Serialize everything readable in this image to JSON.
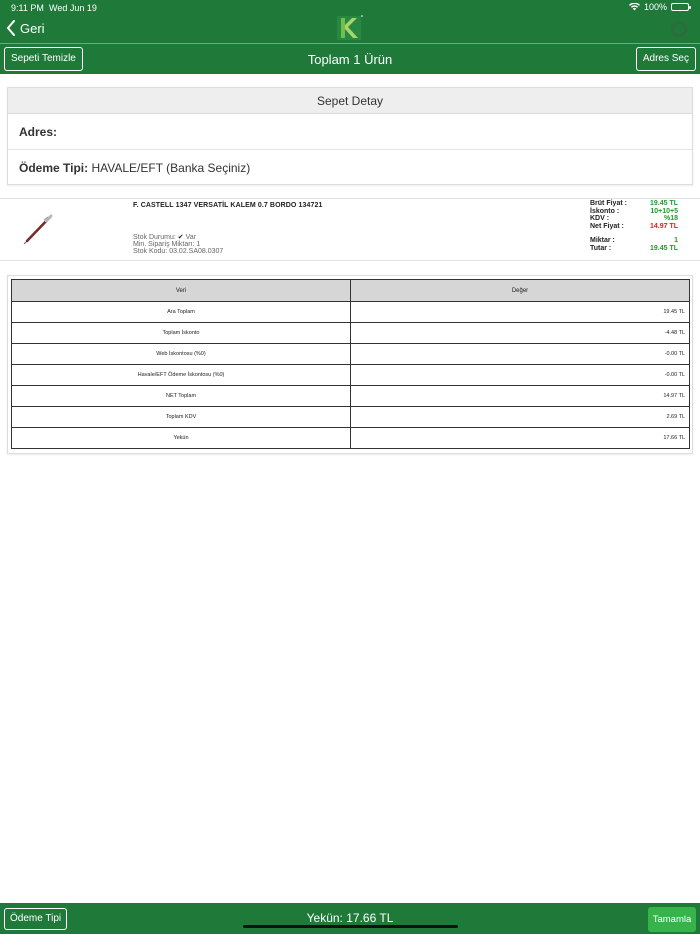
{
  "status": {
    "time": "9:11 PM",
    "date": "Wed Jun 19",
    "battery": "100%"
  },
  "header": {
    "back_label": "Geri",
    "clear_button": "Sepeti Temizle",
    "title": "Toplam 1 Ürün",
    "address_button": "Adres Seç"
  },
  "detail": {
    "heading": "Sepet Detay",
    "address_label": "Adres:",
    "payment_label": "Ödeme Tipi:",
    "payment_value": "HAVALE/EFT (Banka Seçiniz)"
  },
  "product": {
    "name": "F. CASTELL 1347 VERSATİL KALEM 0.7 BORDO 134721",
    "stock_status_label": "Stok Durumu:",
    "stock_status_value": "Var",
    "min_order_label": "Min. Sipariş Miktarı:",
    "min_order_value": "1",
    "stock_code_label": "Stok Kodu:",
    "stock_code_value": "03.02.SA08.0307",
    "gross_price_label": "Brüt Fiyat :",
    "gross_price": "19.45 TL",
    "discount_label": "İskonto :",
    "discount": "10+10+5",
    "vat_label": "KDV :",
    "vat": "%18",
    "net_price_label": "Net Fiyat :",
    "net_price": "14.97 TL",
    "quantity_label": "Miktar :",
    "quantity": "1",
    "amount_label": "Tutar :",
    "amount": "19.45 TL"
  },
  "summary": {
    "col_label": "Veri",
    "col_value": "Değer",
    "rows": [
      {
        "label": "Ara Toplam",
        "value": "19.45 TL"
      },
      {
        "label": "Toplam İskonto",
        "value": "-4.48 TL"
      },
      {
        "label": "Web İskontosu (%0)",
        "value": "-0.00 TL"
      },
      {
        "label": "Havale/EFT Ödeme İskontosu (%0)",
        "value": "-0.00 TL"
      },
      {
        "label": "NET Toplam",
        "value": "14.97 TL"
      },
      {
        "label": "Toplam KDV",
        "value": "2.69 TL"
      },
      {
        "label": "Yekün",
        "value": "17.66 TL"
      }
    ]
  },
  "footer": {
    "payment_button": "Ödeme Tipi",
    "total_text": "Yekün: 17.66 TL",
    "complete_button": "Tamamla"
  },
  "colors": {
    "brand_green": "#1f7a3a",
    "accent_green": "#36b44a",
    "price_green": "#1f9a2e",
    "price_red": "#e02020"
  }
}
